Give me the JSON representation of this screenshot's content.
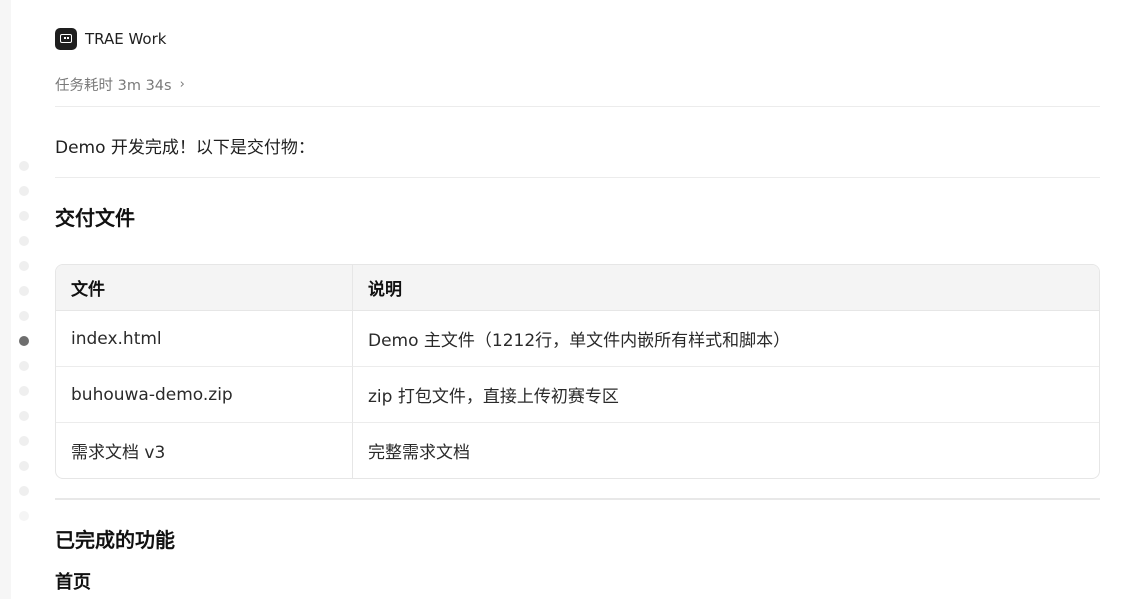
{
  "app": {
    "name": "TRAE Work",
    "logo_icon": "trae-robot-icon"
  },
  "task": {
    "duration_label": "任务耗时 3m 34s",
    "expand_icon": "chevron-right-icon"
  },
  "message": {
    "intro": "Demo 开发完成！以下是交付物："
  },
  "sections": {
    "deliverables_heading": "交付文件",
    "features_heading": "已完成的功能",
    "home_subheading": "首页"
  },
  "table": {
    "headers": [
      "文件",
      "说明"
    ],
    "rows": [
      [
        "index.html",
        "Demo 主文件（1212行，单文件内嵌所有样式和脚本）"
      ],
      [
        "buhouwa-demo.zip",
        "zip 打包文件，直接上传初赛专区"
      ],
      [
        "需求文档 v3",
        "完整需求文档"
      ]
    ]
  },
  "timeline": {
    "dot_count": 15,
    "active_index": 7
  }
}
